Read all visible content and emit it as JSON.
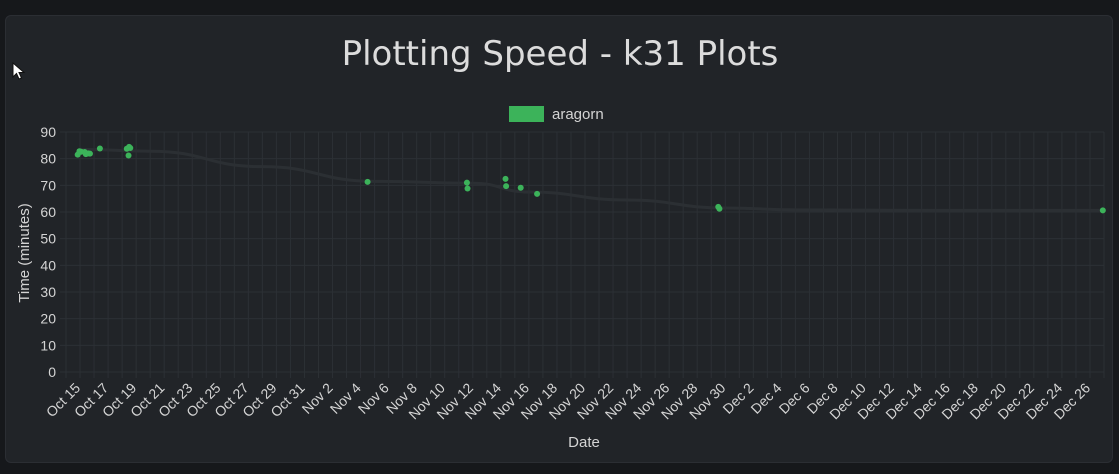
{
  "chart_data": {
    "type": "scatter",
    "title": "Plotting Speed - k31 Plots",
    "xlabel": "Date",
    "ylabel": "Time (minutes)",
    "ylim": [
      0,
      90
    ],
    "y_ticks": [
      0,
      10,
      20,
      30,
      40,
      50,
      60,
      70,
      80,
      90
    ],
    "xlim": [
      "2020-10-14",
      "2020-12-27"
    ],
    "x_tick_labels": [
      "Oct 15",
      "Oct 17",
      "Oct 19",
      "Oct 21",
      "Oct 23",
      "Oct 25",
      "Oct 27",
      "Oct 29",
      "Oct 31",
      "Nov 2",
      "Nov 4",
      "Nov 6",
      "Nov 8",
      "Nov 10",
      "Nov 12",
      "Nov 14",
      "Nov 16",
      "Nov 18",
      "Nov 20",
      "Nov 22",
      "Nov 24",
      "Nov 26",
      "Nov 28",
      "Nov 30",
      "Dec 2",
      "Dec 4",
      "Dec 6",
      "Dec 8",
      "Dec 10",
      "Dec 12",
      "Dec 14",
      "Dec 16",
      "Dec 18",
      "Dec 20",
      "Dec 22",
      "Dec 24",
      "Dec 26"
    ],
    "grid": true,
    "legend_position": "top",
    "trend_line": true,
    "series": [
      {
        "name": "aragorn",
        "color": "#3cb35a",
        "points": [
          {
            "x": "2020-10-14T20:00",
            "y": 81.5
          },
          {
            "x": "2020-10-14T23:00",
            "y": 82.8
          },
          {
            "x": "2020-10-15T02:00",
            "y": 82.6
          },
          {
            "x": "2020-10-15T08:00",
            "y": 82.5
          },
          {
            "x": "2020-10-15T10:00",
            "y": 81.7
          },
          {
            "x": "2020-10-15T14:00",
            "y": 82.0
          },
          {
            "x": "2020-10-15T17:00",
            "y": 81.9
          },
          {
            "x": "2020-10-16T10:00",
            "y": 83.8
          },
          {
            "x": "2020-10-18T08:00",
            "y": 83.7
          },
          {
            "x": "2020-10-18T12:00",
            "y": 84.4
          },
          {
            "x": "2020-10-18T14:00",
            "y": 84.0
          },
          {
            "x": "2020-10-18T11:00",
            "y": 81.2
          },
          {
            "x": "2020-11-04T12:00",
            "y": 71.3
          },
          {
            "x": "2020-11-11T14:00",
            "y": 71.0
          },
          {
            "x": "2020-11-11T15:00",
            "y": 68.8
          },
          {
            "x": "2020-11-14T08:00",
            "y": 72.4
          },
          {
            "x": "2020-11-14T09:00",
            "y": 69.7
          },
          {
            "x": "2020-11-15T10:00",
            "y": 69.1
          },
          {
            "x": "2020-11-16T14:00",
            "y": 66.8
          },
          {
            "x": "2020-11-29T12:00",
            "y": 61.9
          },
          {
            "x": "2020-11-29T14:00",
            "y": 61.2
          },
          {
            "x": "2020-12-26T22:00",
            "y": 60.6
          }
        ]
      }
    ],
    "trend_points": [
      {
        "x": "2020-10-15T00:00",
        "y": 83.5
      },
      {
        "x": "2020-10-20T00:00",
        "y": 82.8
      },
      {
        "x": "2020-10-28T00:00",
        "y": 77.0
      },
      {
        "x": "2020-11-05T00:00",
        "y": 71.5
      },
      {
        "x": "2020-11-12T00:00",
        "y": 70.8
      },
      {
        "x": "2020-11-16T00:00",
        "y": 67.5
      },
      {
        "x": "2020-11-23T00:00",
        "y": 64.5
      },
      {
        "x": "2020-11-30T00:00",
        "y": 61.5
      },
      {
        "x": "2020-12-05T00:00",
        "y": 60.8
      },
      {
        "x": "2020-12-15T00:00",
        "y": 60.6
      },
      {
        "x": "2020-12-27T00:00",
        "y": 60.6
      }
    ]
  },
  "colors": {
    "background": "#16181b",
    "panel": "#212428",
    "grid": "#2c3035",
    "text": "#d4d4d4",
    "title": "#dcdcdc",
    "trend": "#2b2f33"
  }
}
